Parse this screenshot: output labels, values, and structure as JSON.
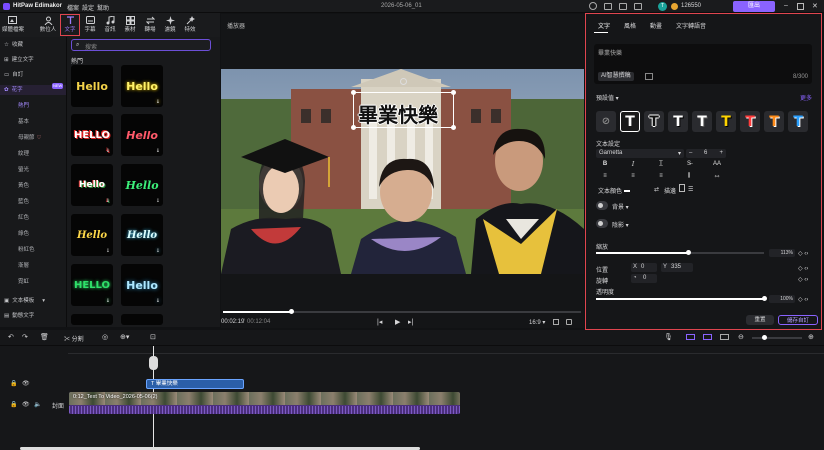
{
  "app": {
    "name": "HitPaw Edimakor",
    "menu": [
      "檔案",
      "設定",
      "幫助"
    ],
    "title": "2026-05-06_01",
    "credits": "126550",
    "export": "匯出"
  },
  "tools": [
    {
      "label": "媒體檔案",
      "icon": "media-icon"
    },
    {
      "label": "數位人",
      "icon": "avatar-icon"
    },
    {
      "label": "文字",
      "icon": "text-icon"
    },
    {
      "label": "字幕",
      "icon": "subtitle-icon"
    },
    {
      "label": "音訊",
      "icon": "audio-icon"
    },
    {
      "label": "素材",
      "icon": "assets-icon"
    },
    {
      "label": "轉場",
      "icon": "transition-icon"
    },
    {
      "label": "濾鏡",
      "icon": "filter-icon"
    },
    {
      "label": "特效",
      "icon": "effects-icon"
    }
  ],
  "sidebar": {
    "items": [
      "收藏",
      "建立文字",
      "自訂"
    ],
    "flower": "花字",
    "badge": "NEW",
    "subs": [
      "熱門",
      "基本",
      "母親節",
      "紋理",
      "螢光",
      "黃色",
      "藍色",
      "紅色",
      "綠色",
      "粉紅色",
      "漸層",
      "霓虹"
    ],
    "bottom": [
      "文本模板",
      "動態文字"
    ]
  },
  "library": {
    "search_placeholder": "搜索",
    "section": "熱門",
    "tile_text": "Hello",
    "tile_text_caps": "HELLO"
  },
  "player": {
    "label": "播放器",
    "overlay_text": "畢業快樂",
    "time_current": "00:02:19",
    "time_total": "00:12:04",
    "ratio": "16:9",
    "progress": 0.19
  },
  "panel": {
    "tabs": [
      "文字",
      "風格",
      "動畫",
      "文字轉語音"
    ],
    "input_placeholder": "畢業快樂",
    "ai_button": "AI智慧撰稿",
    "char_count": "8/300",
    "preset_label": "預設值",
    "more": "更多",
    "text_settings": "文本設定",
    "font": "Garnetta",
    "font_size": "6",
    "text_color": "文本顏色",
    "stroke": "描邊",
    "background": "背景",
    "shadow": "陰影",
    "scale_label": "縮放",
    "scale_value": "113%",
    "position_label": "位置",
    "pos_x_label": "X",
    "pos_x": "0",
    "pos_y_label": "Y",
    "pos_y": "335",
    "rotate_label": "旋轉",
    "rotate_value": "0",
    "opacity_label": "透明度",
    "opacity_value": "100%",
    "reset": "重置",
    "save_custom": "儲存自訂",
    "scale_level": 0.55,
    "opacity_level": 1.0
  },
  "timeline": {
    "split": "分割",
    "text_clip": "畢業快樂",
    "video_clip": "0:12_Text To Video_2026-05-06(2)",
    "cover": "封面"
  },
  "colors": {
    "accent": "#8a63ff",
    "highlight": "#e0454f",
    "clip_text": "#2b5fa8",
    "clip_video": "#4b2f7c"
  }
}
